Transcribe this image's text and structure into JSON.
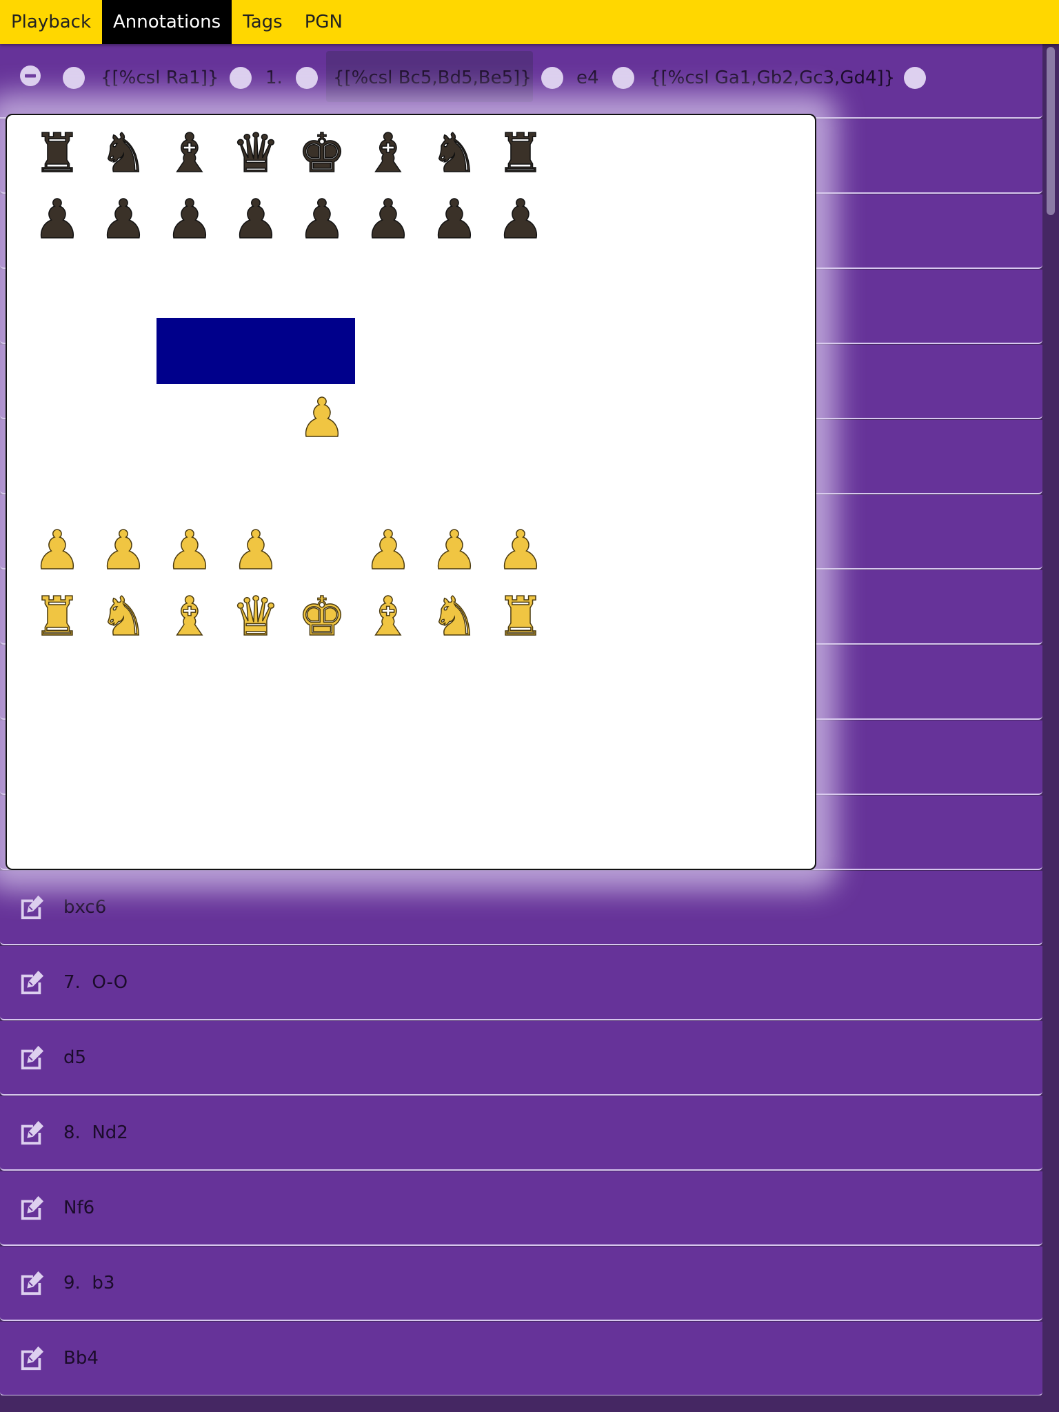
{
  "tabs": [
    {
      "label": "Playback",
      "active": false
    },
    {
      "label": "Annotations",
      "active": true
    },
    {
      "label": "Tags",
      "active": false
    },
    {
      "label": "PGN",
      "active": false
    }
  ],
  "annotation_row": {
    "items": [
      {
        "text": "{[%csl Ra1]}"
      },
      {
        "text": "1."
      },
      {
        "text": "{[%csl Bc5,Bd5,Be5]}",
        "highlighted": true
      },
      {
        "text": "e4"
      },
      {
        "text": "{[%csl Ga1,Gb2,Gc3,Gd4]}"
      }
    ]
  },
  "moves": [
    {
      "label": "bxc6"
    },
    {
      "label": "7.  O-O"
    },
    {
      "label": "d5"
    },
    {
      "label": "8.  Nd2"
    },
    {
      "label": "Nf6"
    },
    {
      "label": "9.  b3"
    },
    {
      "label": "Bb4"
    }
  ],
  "board": {
    "highlight_color": "#00008b",
    "highlight_squares": [
      "c5",
      "d5",
      "e5"
    ],
    "pieces": [
      {
        "sq": "a8",
        "p": "bR"
      },
      {
        "sq": "b8",
        "p": "bN"
      },
      {
        "sq": "c8",
        "p": "bB"
      },
      {
        "sq": "d8",
        "p": "bQ"
      },
      {
        "sq": "e8",
        "p": "bK"
      },
      {
        "sq": "f8",
        "p": "bB"
      },
      {
        "sq": "g8",
        "p": "bN"
      },
      {
        "sq": "h8",
        "p": "bR"
      },
      {
        "sq": "a7",
        "p": "bP"
      },
      {
        "sq": "b7",
        "p": "bP"
      },
      {
        "sq": "c7",
        "p": "bP"
      },
      {
        "sq": "d7",
        "p": "bP"
      },
      {
        "sq": "e7",
        "p": "bP"
      },
      {
        "sq": "f7",
        "p": "bP"
      },
      {
        "sq": "g7",
        "p": "bP"
      },
      {
        "sq": "h7",
        "p": "bP"
      },
      {
        "sq": "e4",
        "p": "wP"
      },
      {
        "sq": "a2",
        "p": "wP"
      },
      {
        "sq": "b2",
        "p": "wP"
      },
      {
        "sq": "c2",
        "p": "wP"
      },
      {
        "sq": "d2",
        "p": "wP"
      },
      {
        "sq": "f2",
        "p": "wP"
      },
      {
        "sq": "g2",
        "p": "wP"
      },
      {
        "sq": "h2",
        "p": "wP"
      },
      {
        "sq": "a1",
        "p": "wR"
      },
      {
        "sq": "b1",
        "p": "wN"
      },
      {
        "sq": "c1",
        "p": "wB"
      },
      {
        "sq": "d1",
        "p": "wQ"
      },
      {
        "sq": "e1",
        "p": "wK"
      },
      {
        "sq": "f1",
        "p": "wB"
      },
      {
        "sq": "g1",
        "p": "wN"
      },
      {
        "sq": "h1",
        "p": "wR"
      }
    ]
  },
  "colors": {
    "tabbar": "#ffd700",
    "row_bg": "#663399",
    "black_piece": "#3a3128",
    "white_piece": "#f0c542"
  }
}
